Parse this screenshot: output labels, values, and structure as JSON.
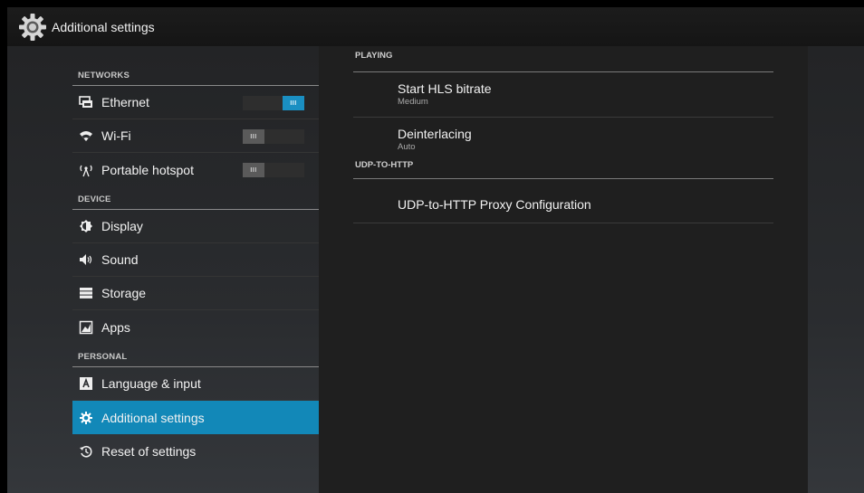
{
  "action_bar": {
    "title": "Additional settings",
    "icon": "gear-icon"
  },
  "sidebar": {
    "sections": [
      {
        "header": "NETWORKS",
        "items": [
          {
            "label": "Ethernet",
            "icon": "ethernet-icon",
            "toggle": {
              "state": "on",
              "label": "III"
            }
          },
          {
            "label": "Wi-Fi",
            "icon": "wifi-icon",
            "toggle": {
              "state": "off",
              "label": "III"
            }
          },
          {
            "label": "Portable hotspot",
            "icon": "hotspot-icon",
            "toggle": {
              "state": "off",
              "label": "III"
            }
          }
        ]
      },
      {
        "header": "DEVICE",
        "items": [
          {
            "label": "Display",
            "icon": "display-icon"
          },
          {
            "label": "Sound",
            "icon": "sound-icon"
          },
          {
            "label": "Storage",
            "icon": "storage-icon"
          },
          {
            "label": "Apps",
            "icon": "apps-icon"
          }
        ]
      },
      {
        "header": "PERSONAL",
        "items": [
          {
            "label": "Language & input",
            "icon": "language-icon"
          },
          {
            "label": "Additional settings",
            "icon": "gear-icon",
            "selected": true
          },
          {
            "label": "Reset of settings",
            "icon": "reset-icon"
          }
        ]
      }
    ]
  },
  "detail": {
    "sections": [
      {
        "header": "PLAYING",
        "items": [
          {
            "title": "Start HLS bitrate",
            "summary": "Medium"
          },
          {
            "title": "Deinterlacing",
            "summary": "Auto"
          }
        ]
      },
      {
        "header": "UDP-TO-HTTP",
        "items": [
          {
            "title": "UDP-to-HTTP Proxy Configuration"
          }
        ]
      }
    ]
  },
  "colors": {
    "accent": "#1288b8",
    "toggle_on": "#1a8fc2"
  }
}
